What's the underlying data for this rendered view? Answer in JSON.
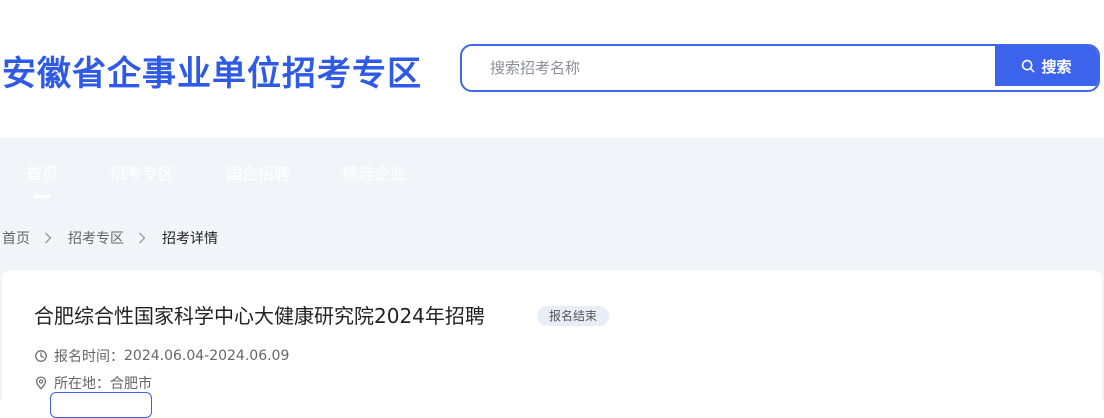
{
  "header": {
    "site_title": "安徽省企事业单位招考专区",
    "search_placeholder": "搜索招考名称",
    "search_button": "搜索"
  },
  "nav": {
    "items": [
      {
        "label": "首页",
        "active": true
      },
      {
        "label": "招考专区",
        "active": false
      },
      {
        "label": "国企招聘",
        "active": false
      },
      {
        "label": "精选企业",
        "active": false
      }
    ]
  },
  "breadcrumb": {
    "items": [
      "首页",
      "招考专区",
      "招考详情"
    ]
  },
  "job": {
    "title": "合肥综合性国家科学中心大健康研究院2024年招聘",
    "status": "报名结束",
    "signup_label": "报名时间：",
    "signup_value": "2024.06.04-2024.06.09",
    "location_label": "所在地：",
    "location_value": "合肥市"
  },
  "colors": {
    "brand": "#2e5ae6",
    "button": "#3b63ec",
    "nav_bg": "#f2f4f9"
  }
}
